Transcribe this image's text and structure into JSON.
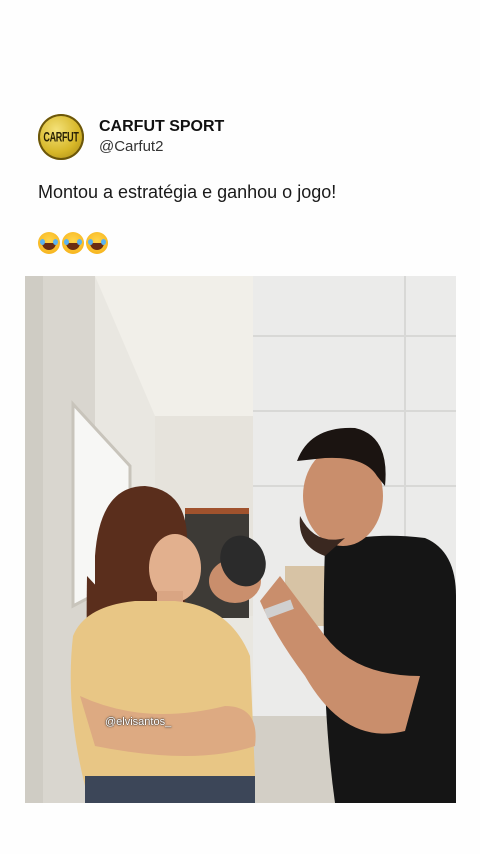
{
  "post": {
    "author": {
      "display_name": "CARFUT SPORT",
      "handle": "@Carfut2",
      "avatar_text": "CARFUT"
    },
    "text": "Montou a estratégia e ganhou o jogo!",
    "emojis": [
      "face-with-tears-of-joy",
      "face-with-tears-of-joy",
      "face-with-tears-of-joy"
    ],
    "media": {
      "watermark": "@elvisantos_"
    }
  },
  "colors": {
    "background": "#fefefe",
    "text": "#1a1a1a",
    "avatar_gold": "#d7b728"
  }
}
